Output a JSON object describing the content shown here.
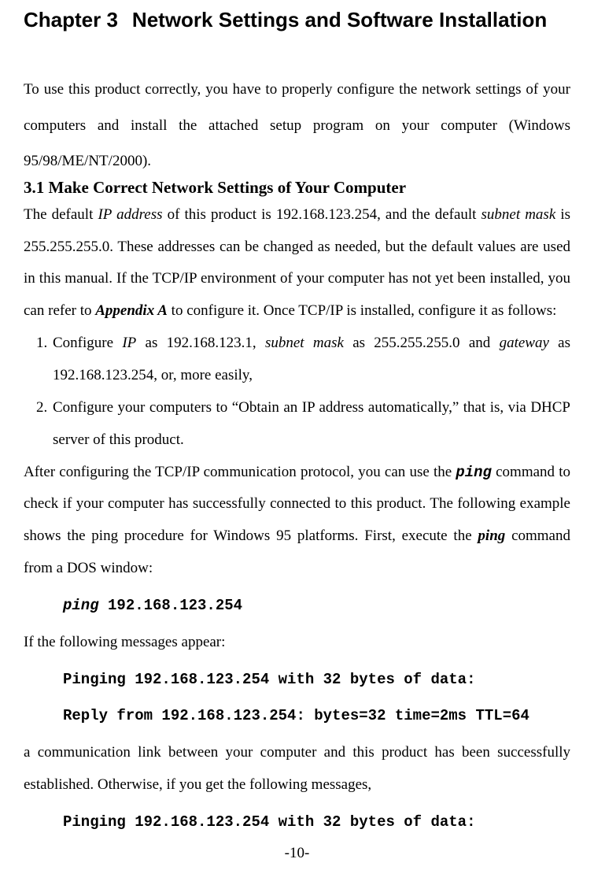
{
  "chapter": {
    "label": "Chapter 3",
    "title": "Network Settings and Software Installation"
  },
  "intro": {
    "t1": "To use this product correctly, you have to properly configure the network settings of your computers and install the attached setup program on your computer (Windows 95/98/ME/NT/2000)."
  },
  "section": {
    "title": "3.1 Make Correct Network Settings of Your Computer",
    "p1a": "The default ",
    "ip_label": "IP address",
    "p1b": " of this product is 192.168.123.254, and the default ",
    "subnet_label": "subnet mask",
    "p1c": " is 255.255.255.0. These addresses can be changed as needed, but the default values are used in this manual. If the TCP/IP environment of your computer has not yet been  installed, you can refer to ",
    "appendix": "Appendix A",
    "p1d": " to configure it. Once TCP/IP is installed, configure it as follows:"
  },
  "list": {
    "i1a": "Configure ",
    "i1_ip": "IP",
    "i1b": " as 192.168.123.1, ",
    "i1_mask": "subnet mask",
    "i1c": " as 255.255.255.0 and ",
    "i1_gw": "gateway",
    "i1d": " as 192.168.123.254, or, more easily,",
    "i2": "Configure your computers to “Obtain an IP address automatically,” that is, via DHCP server of this product."
  },
  "after": {
    "p2a": "After configuring the TCP/IP communication protocol, you can use the ",
    "cmd1": "ping",
    "p2b": " command to check if your computer has successfully connected to this product. The following example shows the ping procedure for Windows 95 platforms. First, execute the ",
    "cmd2": "ping",
    "p2c": " command from a DOS window:",
    "code1": "ping 192.168.123.254",
    "p3": "If the following messages appear:",
    "code2a": "Pinging 192.168.123.254 with 32 bytes of data:",
    "code2b": "Reply from 192.168.123.254: bytes=32 time=2ms TTL=64",
    "p4": "a communication link between your computer and this product has been successfully established. Otherwise, if you get the following messages,",
    "code3": "Pinging 192.168.123.254 with 32 bytes of data:"
  },
  "page": "-10-"
}
